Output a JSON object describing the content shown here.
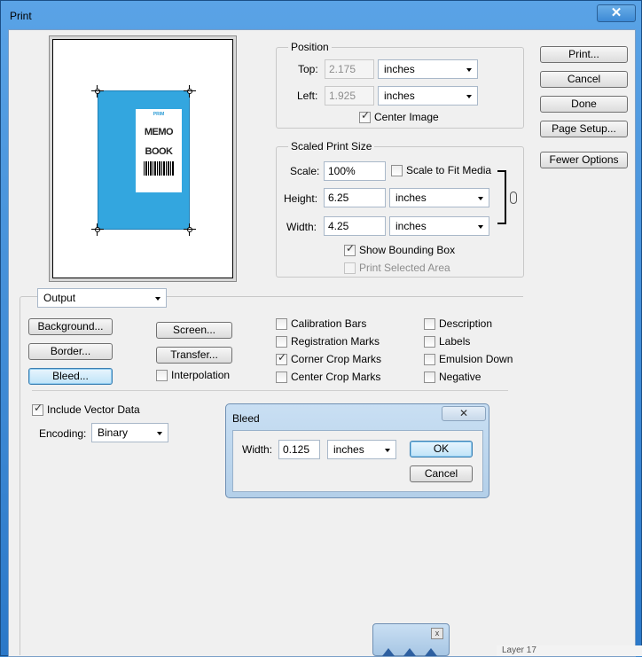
{
  "window": {
    "title": "Print",
    "close_glyph": "✕"
  },
  "preview": {
    "book_brand": "PRIM",
    "book_title_line1": "MEMO",
    "book_title_line2": "BOOK"
  },
  "position": {
    "title": "Position",
    "top_label": "Top:",
    "top_value": "2.175",
    "top_unit": "inches",
    "left_label": "Left:",
    "left_value": "1.925",
    "left_unit": "inches",
    "center_image_label": "Center Image",
    "center_image_checked": true
  },
  "scaled": {
    "title": "Scaled Print Size",
    "scale_label": "Scale:",
    "scale_value": "100%",
    "fit_label": "Scale to Fit Media",
    "height_label": "Height:",
    "height_value": "6.25",
    "height_unit": "inches",
    "width_label": "Width:",
    "width_value": "4.25",
    "width_unit": "inches",
    "bounding_box_label": "Show Bounding Box",
    "print_selected_label": "Print Selected Area",
    "link_icon": "chain-link-icon"
  },
  "buttons": {
    "print": "Print...",
    "cancel": "Cancel",
    "done": "Done",
    "page_setup": "Page Setup...",
    "fewer_options": "Fewer Options"
  },
  "output": {
    "section_select": "Output",
    "background": "Background...",
    "border": "Border...",
    "bleed": "Bleed...",
    "screen": "Screen...",
    "transfer": "Transfer...",
    "interpolation": "Interpolation",
    "calibration_bars": "Calibration Bars",
    "registration_marks": "Registration Marks",
    "corner_crop_marks": "Corner Crop Marks",
    "center_crop_marks": "Center Crop Marks",
    "description": "Description",
    "labels": "Labels",
    "emulsion_down": "Emulsion Down",
    "negative": "Negative",
    "include_vector": "Include Vector Data",
    "encoding_label": "Encoding:",
    "encoding_value": "Binary"
  },
  "bleed_dialog": {
    "title": "Bleed",
    "close_glyph": "✕",
    "width_label": "Width:",
    "width_value": "0.125",
    "unit": "inches",
    "ok": "OK",
    "cancel": "Cancel"
  },
  "panel": {
    "close_glyph": "x"
  },
  "background_fragment": {
    "text": "Layer 17"
  }
}
